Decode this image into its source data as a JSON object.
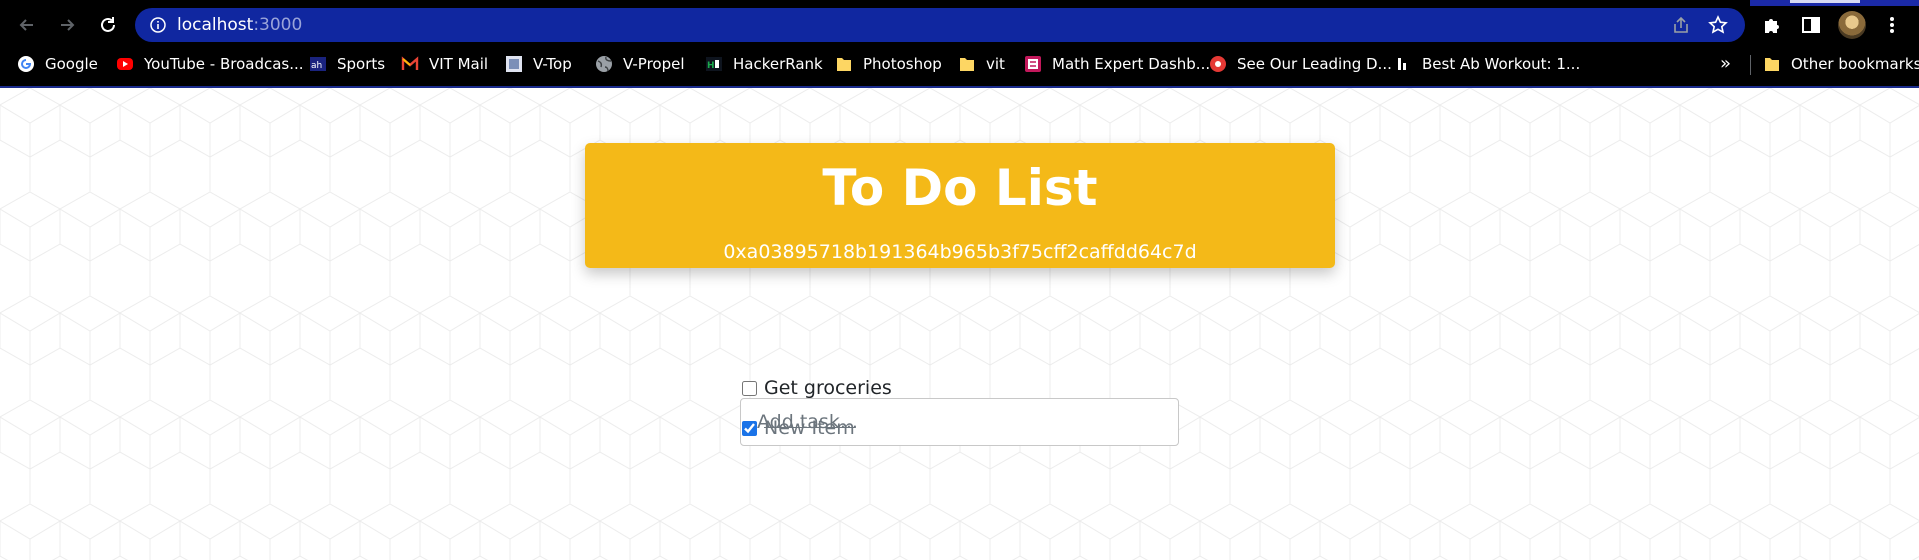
{
  "browser": {
    "url_host": "localhost",
    "url_port": ":3000",
    "icons": {
      "back": "arrow-left-icon",
      "forward": "arrow-right-icon",
      "reload": "reload-icon",
      "site_info": "info-icon",
      "share": "share-icon",
      "bookmark": "star-icon",
      "extensions": "puzzle-icon",
      "side_panel": "side-panel-icon",
      "menu": "kebab-menu-icon"
    },
    "colors": {
      "omnibox": "#1027a0",
      "chrome": "#000000"
    }
  },
  "bookmarks": {
    "items": [
      {
        "label": "Google",
        "icon": "google-icon"
      },
      {
        "label": "YouTube - Broadcas...",
        "icon": "youtube-icon"
      },
      {
        "label": "Sports",
        "icon": "sports-icon"
      },
      {
        "label": "VIT Mail",
        "icon": "gmail-icon"
      },
      {
        "label": "V-Top",
        "icon": "vtop-icon"
      },
      {
        "label": "V-Propel",
        "icon": "globe-icon"
      },
      {
        "label": "HackerRank",
        "icon": "hackerrank-icon"
      },
      {
        "label": "Photoshop",
        "icon": "folder-icon"
      },
      {
        "label": "vit",
        "icon": "folder-icon"
      },
      {
        "label": "Math Expert Dashb...",
        "icon": "math-expert-icon"
      },
      {
        "label": "See Our Leading D...",
        "icon": "record-icon"
      },
      {
        "label": "Best Ab Workout: 1...",
        "icon": "workout-icon"
      }
    ],
    "more": "»",
    "other": {
      "label": "Other bookmarks",
      "icon": "folder-icon"
    }
  },
  "app": {
    "title": "To Do List",
    "account": "0xa03895718b191364b965b3f75cff2caffdd64c7d",
    "input_placeholder": "Add task...",
    "tasks": [
      {
        "label": "Get groceries",
        "completed": false
      },
      {
        "label": "New Item",
        "completed": true
      }
    ],
    "colors": {
      "header": "#f4b918"
    }
  }
}
